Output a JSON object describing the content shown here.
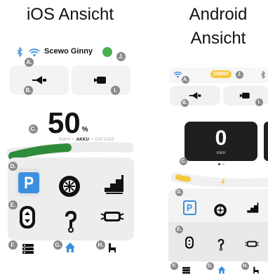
{
  "headings": {
    "ios": "iOS Ansicht",
    "android_line1": "Android",
    "android_line2": "Ansicht"
  },
  "ios": {
    "device_name": "Scewo Ginny",
    "status_color": "#4caf50",
    "big_value": "50",
    "big_unit": "%",
    "tabs": [
      "KM/H",
      "AKKU",
      "DISTANZ"
    ],
    "tab_separator": "•",
    "active_tab_index": 1,
    "battery_level": 0.5,
    "battery_color": "#2e8b3a"
  },
  "android": {
    "device_pill": "GINNY",
    "speed_value": "0",
    "speed_unit": "KM/H",
    "battery_color": "#f5c842"
  },
  "markers": {
    "a": "A.",
    "b": "B.",
    "c": "C.",
    "d": "D.",
    "e": "E.",
    "f": "F.",
    "g": "G.",
    "h": "H.",
    "i": "I.",
    "j": "J."
  },
  "colors": {
    "accent_blue": "#3b8fe0",
    "parking_blue": "#3b8fe0",
    "marker_gray": "#8a8a8a",
    "panel_gray": "#ededed"
  },
  "icons": [
    "bluetooth-icon",
    "wifi-icon",
    "horn-icon",
    "camera-icon",
    "parking-icon",
    "wheel-icon",
    "stairs-icon",
    "balance-icon",
    "hook-icon",
    "lights-icon",
    "settings-icon",
    "home-icon",
    "seat-icon"
  ]
}
